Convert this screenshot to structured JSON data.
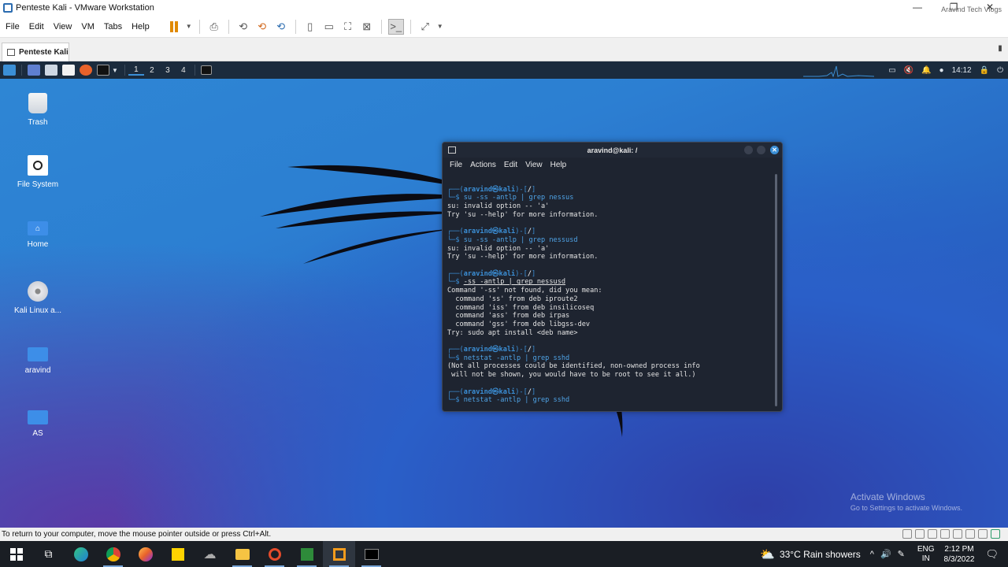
{
  "vmware": {
    "title": "Penteste Kali - VMware Workstation",
    "watermark": "Aravind Tech Vlogs",
    "menu": [
      "File",
      "Edit",
      "View",
      "VM",
      "Tabs",
      "Help"
    ],
    "tab_label": "Penteste Kali",
    "status_text": "To return to your computer, move the mouse pointer outside or press Ctrl+Alt."
  },
  "kali_panel": {
    "workspaces": [
      "1",
      "2",
      "3",
      "4"
    ],
    "time": "14:12"
  },
  "desktop": {
    "icons": [
      {
        "label": "Trash",
        "icon": "trash-icon"
      },
      {
        "label": "File System",
        "icon": "drive-icon"
      },
      {
        "label": "Home",
        "icon": "home-folder-icon"
      },
      {
        "label": "Kali Linux a...",
        "icon": "disc-icon"
      },
      {
        "label": "aravind",
        "icon": "folder-icon"
      },
      {
        "label": "AS",
        "icon": "folder-icon"
      }
    ],
    "activate_title": "Activate Windows",
    "activate_sub": "Go to Settings to activate Windows."
  },
  "terminal": {
    "title": "aravind@kali: /",
    "menu": [
      "File",
      "Actions",
      "Edit",
      "View",
      "Help"
    ],
    "prompt_user": "aravind",
    "prompt_host": "kali",
    "prompt_dir": "/",
    "blocks": [
      {
        "cmd": "su -ss -antlp | grep nessus",
        "output": [
          "su: invalid option -- 'a'",
          "Try 'su --help' for more information."
        ]
      },
      {
        "cmd": "su -ss -antlp | grep nessusd",
        "output": [
          "su: invalid option -- 'a'",
          "Try 'su --help' for more information."
        ]
      },
      {
        "cmd": "-ss -antlp | grep nessusd",
        "output": [
          "Command '-ss' not found, did you mean:",
          "  command 'ss' from deb iproute2",
          "  command 'iss' from deb insilicoseq",
          "  command 'ass' from deb irpas",
          "  command 'gss' from deb libgss-dev",
          "Try: sudo apt install <deb name>"
        ]
      },
      {
        "cmd": "netstat -antlp | grep sshd",
        "output": [
          "(Not all processes could be identified, non-owned process info",
          " will not be shown, you would have to be root to see it all.)"
        ]
      }
    ],
    "current_cmd": "netstat -antlp | grep sshd"
  },
  "taskbar": {
    "weather": "33°C  Rain showers",
    "lang_top": "ENG",
    "lang_bottom": "IN",
    "time": "2:12 PM",
    "date": "8/3/2022"
  }
}
